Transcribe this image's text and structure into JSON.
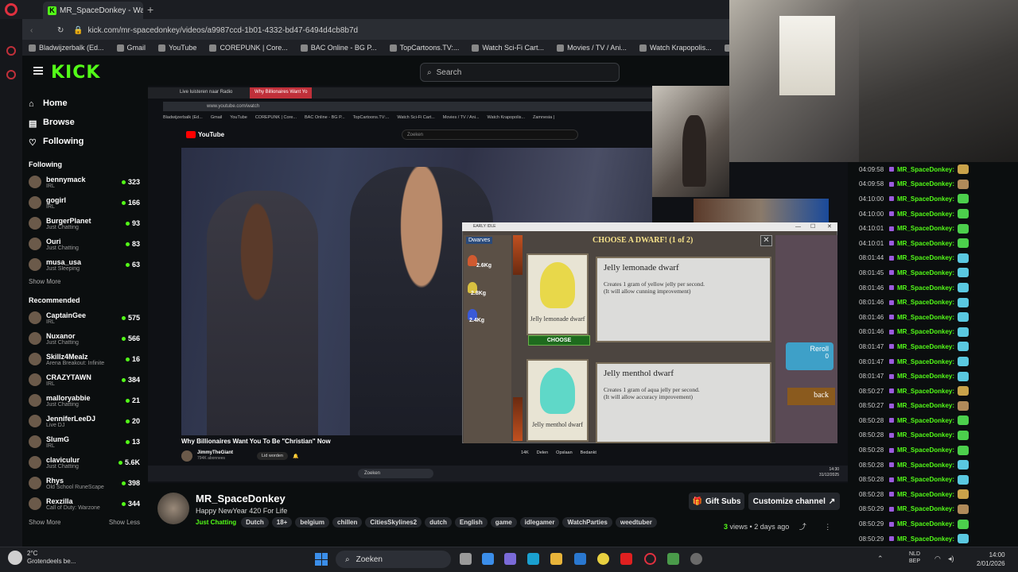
{
  "browser": {
    "tab_title": "MR_SpaceDonkey - Wa",
    "url": "kick.com/mr-spacedonkey/videos/a9987ccd-1b01-4332-bd47-6494d4cb8b7d",
    "bookmarks": [
      "Bladwijzerbalk (Ed...",
      "Gmail",
      "YouTube",
      "COREPUNK | Core...",
      "BAC Online - BG P...",
      "TopCartoons.TV:...",
      "Watch Sci-Fi Cart...",
      "Movies / TV / Ani...",
      "Watch Krapopolis...",
      "Zamnesia |"
    ]
  },
  "kick": {
    "logo": "KICK",
    "search_placeholder": "Search",
    "nav": [
      "Home",
      "Browse",
      "Following"
    ],
    "following_title": "Following",
    "following": [
      {
        "name": "bennymack",
        "cat": "IRL",
        "viewers": "323"
      },
      {
        "name": "gogirl",
        "cat": "IRL",
        "viewers": "166"
      },
      {
        "name": "BurgerPlanet",
        "cat": "Just Chatting",
        "viewers": "93"
      },
      {
        "name": "Ouri",
        "cat": "Just Chatting",
        "viewers": "83"
      },
      {
        "name": "musa_usa",
        "cat": "Just Sleeping",
        "viewers": "63"
      }
    ],
    "show_more": "Show More",
    "recommended_title": "Recommended",
    "recommended": [
      {
        "name": "CaptainGee",
        "cat": "IRL",
        "viewers": "575"
      },
      {
        "name": "Nuxanor",
        "cat": "Just Chatting",
        "viewers": "566"
      },
      {
        "name": "Skillz4Mealz",
        "cat": "Arena Breakout: Infinite",
        "viewers": "16"
      },
      {
        "name": "CRAZYTAWN",
        "cat": "IRL",
        "viewers": "384"
      },
      {
        "name": "malloryabbie",
        "cat": "Just Chatting",
        "viewers": "21"
      },
      {
        "name": "JenniferLeeDJ",
        "cat": "Live DJ",
        "viewers": "20"
      },
      {
        "name": "SlumG",
        "cat": "IRL",
        "viewers": "13"
      },
      {
        "name": "claviculur",
        "cat": "Just Chatting",
        "viewers": "5.6K"
      },
      {
        "name": "Rhys",
        "cat": "Old School RuneScape",
        "viewers": "398"
      },
      {
        "name": "Rexzilla",
        "cat": "Call of Duty: Warzone",
        "viewers": "344"
      }
    ],
    "show_less": "Show Less"
  },
  "inner": {
    "tab1": "Live luisteren naar Radio",
    "tab2": "Why Billionaires Want Yo",
    "url": "www.youtube.com/watch",
    "yt_search": "Zoeken",
    "video_title": "Why Billionaires Want You To Be \"Christian\" Now",
    "yt_channel": "JimmyTheGiant",
    "yt_subs": "794K abonnees",
    "join": "Lid worden",
    "likes": "14K",
    "share": "Delen",
    "save": "Opslaan",
    "thanks": "Bedankt",
    "taskbar_search": "Zoeken",
    "clock": "14:30\n31/12/2025"
  },
  "game": {
    "window_title": "EARLY IDLE",
    "owned_label": "Dwarves",
    "weights": [
      "2.6Kg",
      "2.8Kg",
      "2.4Kg"
    ],
    "choose_title": "CHOOSE A DWARF! (1 of 2)",
    "cards": [
      {
        "name": "Jelly lemonade dwarf",
        "title": "Jelly lemonade dwarf",
        "desc1": "Creates 1 gram of yellow jelly per second.",
        "desc2": "(It will allow cunning improvement)",
        "color": "#e8d84a"
      },
      {
        "name": "Jelly menthol dwarf",
        "title": "Jelly menthol dwarf",
        "desc1": "Creates 1 gram of aqua jelly per second.",
        "desc2": "(It will allow accuracy improvement)",
        "color": "#5fd8c8"
      }
    ],
    "choose_label": "CHOOSE",
    "reroll": "Reroll",
    "reroll_count": "0",
    "back": "back"
  },
  "chat": [
    {
      "t": "04:09:58",
      "n": "MR_SpaceDonkey:",
      "e": "#c9a24a"
    },
    {
      "t": "04:09:58",
      "n": "MR_SpaceDonkey:",
      "e": "#b08a5a"
    },
    {
      "t": "04:10:00",
      "n": "MR_SpaceDonkey:",
      "e": "#4ccf4c"
    },
    {
      "t": "04:10:00",
      "n": "MR_SpaceDonkey:",
      "e": "#4ccf4c"
    },
    {
      "t": "04:10:01",
      "n": "MR_SpaceDonkey:",
      "e": "#4ccf4c"
    },
    {
      "t": "04:10:01",
      "n": "MR_SpaceDonkey:",
      "e": "#4ccf4c"
    },
    {
      "t": "08:01:44",
      "n": "MR_SpaceDonkey:",
      "e": "#5ac8e0"
    },
    {
      "t": "08:01:45",
      "n": "MR_SpaceDonkey:",
      "e": "#5ac8e0"
    },
    {
      "t": "08:01:46",
      "n": "MR_SpaceDonkey:",
      "e": "#5ac8e0"
    },
    {
      "t": "08:01:46",
      "n": "MR_SpaceDonkey:",
      "e": "#5ac8e0"
    },
    {
      "t": "08:01:46",
      "n": "MR_SpaceDonkey:",
      "e": "#5ac8e0"
    },
    {
      "t": "08:01:46",
      "n": "MR_SpaceDonkey:",
      "e": "#5ac8e0"
    },
    {
      "t": "08:01:47",
      "n": "MR_SpaceDonkey:",
      "e": "#5ac8e0"
    },
    {
      "t": "08:01:47",
      "n": "MR_SpaceDonkey:",
      "e": "#5ac8e0"
    },
    {
      "t": "08:01:47",
      "n": "MR_SpaceDonkey:",
      "e": "#5ac8e0"
    },
    {
      "t": "08:50:27",
      "n": "MR_SpaceDonkey:",
      "e": "#c9a24a"
    },
    {
      "t": "08:50:27",
      "n": "MR_SpaceDonkey:",
      "e": "#b08a5a"
    },
    {
      "t": "08:50:28",
      "n": "MR_SpaceDonkey:",
      "e": "#4ccf4c"
    },
    {
      "t": "08:50:28",
      "n": "MR_SpaceDonkey:",
      "e": "#4ccf4c"
    },
    {
      "t": "08:50:28",
      "n": "MR_SpaceDonkey:",
      "e": "#4ccf4c"
    },
    {
      "t": "08:50:28",
      "n": "MR_SpaceDonkey:",
      "e": "#5ac8e0"
    },
    {
      "t": "08:50:28",
      "n": "MR_SpaceDonkey:",
      "e": "#5ac8e0"
    },
    {
      "t": "08:50:28",
      "n": "MR_SpaceDonkey:",
      "e": "#c9a24a"
    },
    {
      "t": "08:50:29",
      "n": "MR_SpaceDonkey:",
      "e": "#b08a5a"
    },
    {
      "t": "08:50:29",
      "n": "MR_SpaceDonkey:",
      "e": "#4ccf4c"
    },
    {
      "t": "08:50:29",
      "n": "MR_SpaceDonkey:",
      "e": "#5ac8e0"
    }
  ],
  "channel": {
    "name": "MR_SpaceDonkey",
    "title": "Happy NewYear 420 For Life",
    "category": "Just Chatting",
    "tags": [
      "Dutch",
      "18+",
      "belgium",
      "chillen",
      "CitiesSkylines2",
      "dutch",
      "English",
      "game",
      "idlegamer",
      "WatchParties",
      "weedtuber"
    ],
    "gift": "Gift Subs",
    "customize": "Customize channel",
    "views_num": "3",
    "views_label": "views",
    "ago": "2 days ago"
  },
  "taskbar": {
    "temp": "2°C",
    "weather": "Grotendeels be...",
    "search": "Zoeken",
    "lang1": "NLD",
    "lang2": "BEP",
    "time": "14:00",
    "date": "2/01/2026"
  },
  "colors": {
    "kick_green": "#53fc18",
    "opera_red": "#e0303f"
  }
}
